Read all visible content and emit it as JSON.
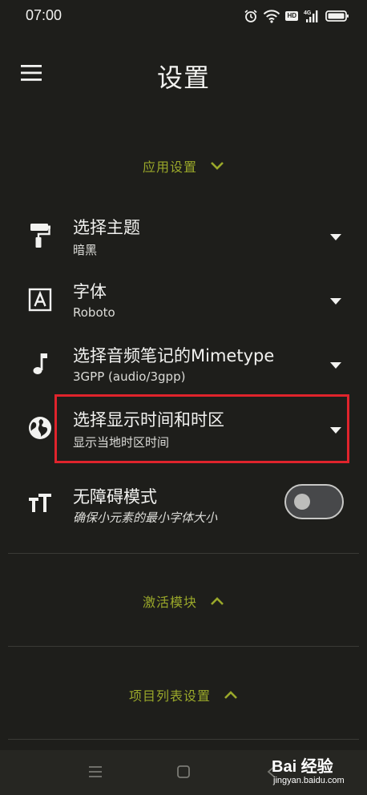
{
  "status_bar": {
    "time": "07:00",
    "icons": [
      "alarm-icon",
      "wifi-icon",
      "hd-badge",
      "signal-4g-icon",
      "battery-icon"
    ],
    "hd_label": "HD",
    "network_label": "4G"
  },
  "header": {
    "title": "设置",
    "menu_icon": "hamburger-menu-icon"
  },
  "sections": {
    "app_settings": {
      "label": "应用设置",
      "state": "expanded"
    },
    "activation_modules": {
      "label": "激活模块",
      "state": "collapsed"
    },
    "project_list_settings": {
      "label": "项目列表设置",
      "state": "collapsed"
    }
  },
  "settings": {
    "theme": {
      "title": "选择主题",
      "value": "暗黑",
      "icon": "paint-roller-icon"
    },
    "font": {
      "title": "字体",
      "value": "Roboto",
      "icon": "font-a-icon"
    },
    "audio_mimetype": {
      "title": "选择音频笔记的Mimetype",
      "value": "3GPP (audio/3gpp)",
      "icon": "music-note-icon"
    },
    "time_zone": {
      "title": "选择显示时间和时区",
      "value": "显示当地时区时间",
      "icon": "globe-icon"
    },
    "accessibility": {
      "title": "无障碍模式",
      "description": "确保小元素的最小字体大小",
      "icon": "text-size-icon",
      "enabled": false
    }
  },
  "nav_bar": {
    "buttons": [
      "recent-apps-icon",
      "home-icon",
      "back-icon"
    ]
  },
  "watermark": {
    "logo": "Bai 经验",
    "url": "jingyan.baidu.com"
  },
  "colors": {
    "background": "#1e1e1b",
    "accent": "#9aa82a",
    "highlight": "#e0242c"
  }
}
